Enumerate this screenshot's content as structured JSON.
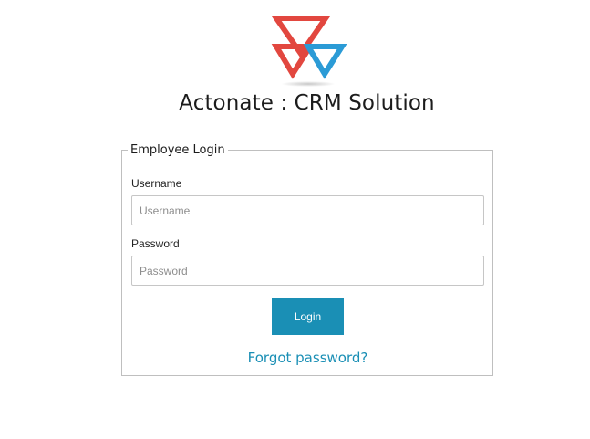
{
  "app": {
    "title": "Actonate : CRM Solution",
    "logo_icon": "triangles-logo-icon",
    "colors": {
      "red": "#e2473f",
      "blue": "#2b9bd6",
      "accent": "#1a8fb5"
    }
  },
  "login": {
    "legend": "Employee Login",
    "username_label": "Username",
    "username_placeholder": "Username",
    "username_value": "",
    "password_label": "Password",
    "password_placeholder": "Password",
    "password_value": "",
    "login_button": "Login",
    "forgot_link": "Forgot password?"
  }
}
